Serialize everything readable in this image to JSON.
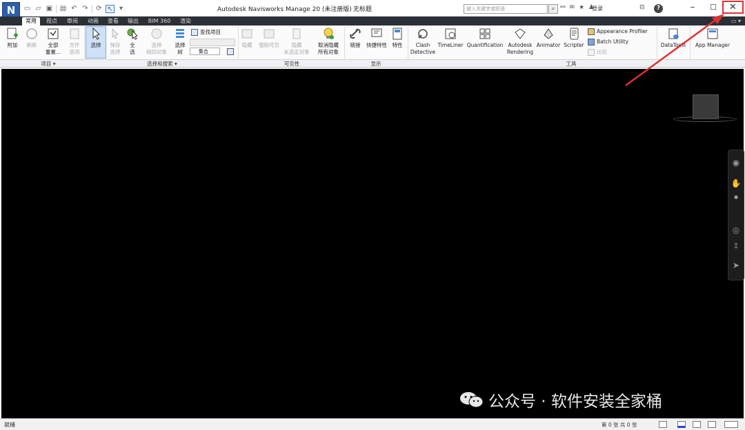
{
  "titlebar": {
    "logo": "N",
    "title": "Autodesk Navisworks Manage 20   (未注册版)",
    "file": "无标题",
    "search_placeholder": "键入关键字或短语",
    "login": "登录"
  },
  "tabs": [
    "常用",
    "视点",
    "审阅",
    "动画",
    "查看",
    "输出",
    "BIM 360",
    "渲染"
  ],
  "ribbon": {
    "append": "附加",
    "refresh": "刷新",
    "reset_all_1": "全部",
    "reset_all_2": "重置...",
    "file_options_1": "文件",
    "file_options_2": "选项",
    "select": "选择",
    "save_selection_1": "保存",
    "save_selection_2": "选择",
    "select_all_1": "全",
    "select_all_2": "选",
    "select_same_1": "选择",
    "select_same_2": "相同对象",
    "selection_tree_1": "选择",
    "selection_tree_2": "树",
    "find_items": "查找项目",
    "sets": "集合",
    "hide": "隐藏",
    "require": "强制可见",
    "hide_unselected_1": "隐藏",
    "hide_unselected_2": "未选定对象",
    "unhide_all_1": "取消隐藏",
    "unhide_all_2": "所有对象",
    "links": "链接",
    "quick_props": "快捷特性",
    "properties": "特性",
    "clash_1": "Clash",
    "clash_2": "Detective",
    "timeliner": "TimeLiner",
    "quantification": "Quantification",
    "rendering_1": "Autodesk",
    "rendering_2": "Rendering",
    "animator": "Animator",
    "scripter": "Scripter",
    "appearance_profiler": "Appearance Profiler",
    "batch_utility": "Batch Utility",
    "compare": "比较",
    "datatools": "DataTools",
    "app_manager": "App Manager"
  },
  "groups": {
    "project": "项目",
    "select_search": "选择和搜索",
    "visibility": "可见性",
    "display": "显示",
    "tools": "工具"
  },
  "watermark": "公众号 · 软件安装全家桶",
  "status": {
    "ready": "就绪",
    "page": "第 0 张  共 0 张"
  },
  "colors": {
    "highlight": "#e03030",
    "viewport": "#000000",
    "tab_bar": "#2b2f36"
  }
}
